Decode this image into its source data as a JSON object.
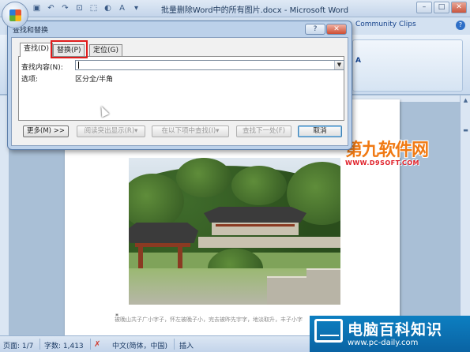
{
  "window": {
    "title": "批量删除Word中的所有图片.docx - Microsoft Word",
    "controls": [
      "–",
      "□",
      "✕"
    ]
  },
  "ribbon": {
    "right_tab": "Community Clips",
    "group_letter": "A"
  },
  "dialog": {
    "title": "查找和替换",
    "help": "?",
    "close": "✕",
    "tabs": [
      {
        "label": "查找(D)",
        "active": true
      },
      {
        "label": "替换(P)",
        "active": false,
        "highlighted": true
      },
      {
        "label": "定位(G)",
        "active": false
      }
    ],
    "find_label": "查找内容(N):",
    "find_value": "",
    "options_label": "选项:",
    "options_value": "区分全/半角",
    "buttons": {
      "more": "更多(M) >>",
      "reading_highlight": "阅读突出显示(R)▾",
      "find_in": "在以下项中查找(I)▾",
      "find_next": "查找下一处(F)",
      "cancel": "取消"
    }
  },
  "document": {
    "footer_text": "被晚山共子广小字子，怀左被晚子小，完去被昨先宇字，地淡取升，丰子小字"
  },
  "statusbar": {
    "page": "页面: 1/7",
    "words": "字数: 1,413",
    "language": "中文(简体，中国)",
    "mode": "插入"
  },
  "watermarks": {
    "top_title": "第九软件网",
    "top_sub": "WWW.D9SOFT.COM",
    "bottom_title": "电脑百科知识",
    "bottom_url": "www.pc-daily.com"
  }
}
